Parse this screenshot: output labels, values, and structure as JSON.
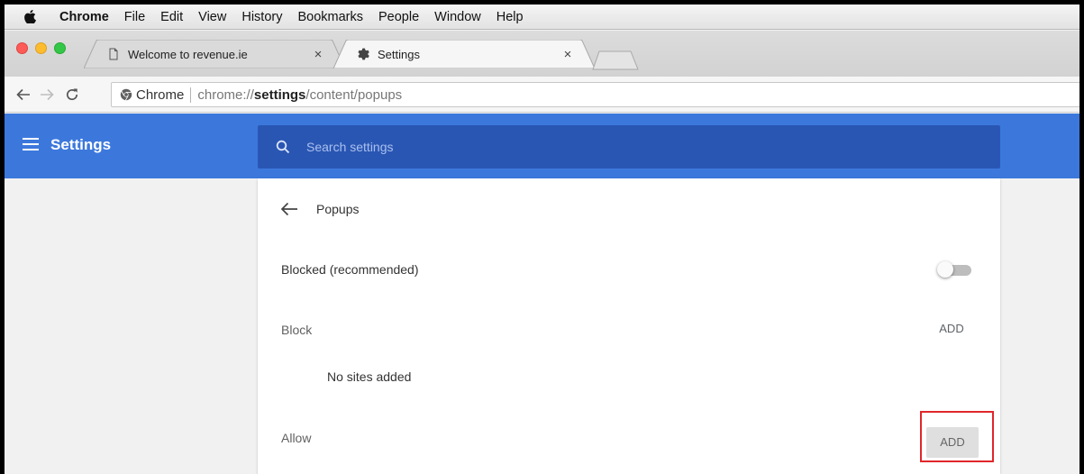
{
  "menubar": {
    "app": "Chrome",
    "items": [
      "File",
      "Edit",
      "View",
      "History",
      "Bookmarks",
      "People",
      "Window",
      "Help"
    ]
  },
  "tabs": [
    {
      "label": "Welcome to revenue.ie",
      "icon": "page-icon",
      "close": "×"
    },
    {
      "label": "Settings",
      "icon": "gear-icon",
      "close": "×"
    }
  ],
  "omnibox": {
    "scheme_label": "Chrome",
    "url_pre": "chrome://",
    "url_host": "settings",
    "url_post": "/content/popups"
  },
  "header": {
    "title": "Settings",
    "search_placeholder": "Search settings"
  },
  "popups": {
    "title": "Popups",
    "blocked_label": "Blocked (recommended)",
    "blocked_enabled": false,
    "block_label": "Block",
    "block_add": "ADD",
    "block_empty": "No sites added",
    "allow_label": "Allow",
    "allow_add": "ADD"
  },
  "colors": {
    "header_blue": "#3c78dc",
    "search_blue": "#2a56b3",
    "highlight_red": "#e0262a"
  }
}
